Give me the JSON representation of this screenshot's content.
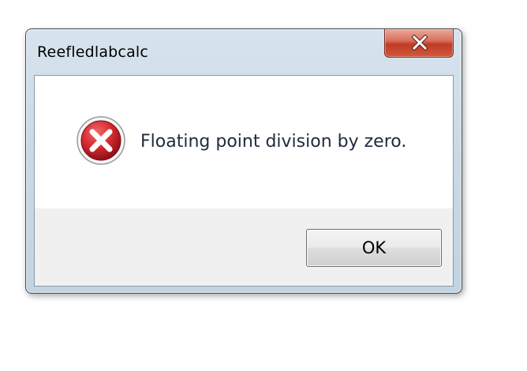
{
  "window": {
    "title": "Reefledlabcalc"
  },
  "dialog": {
    "message": "Floating point division by zero.",
    "icon": "error-icon"
  },
  "buttons": {
    "ok_label": "OK",
    "close_icon": "close-icon"
  },
  "colors": {
    "close_button": "#c13b24",
    "error_icon": "#c8202a",
    "title_bar": "#cbd9e6",
    "button_area": "#f0f0f0"
  }
}
